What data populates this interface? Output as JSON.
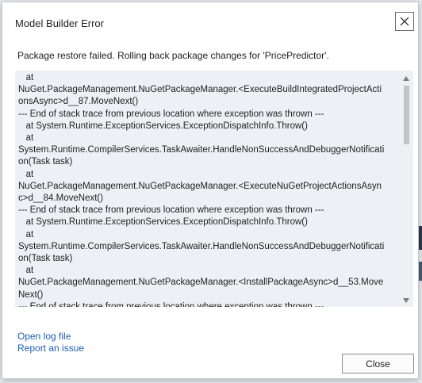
{
  "dialog": {
    "title": "Model Builder Error",
    "close_icon": "close-icon",
    "message": "Package restore failed. Rolling back package changes for 'PricePredictor'.",
    "stack_trace_lines": [
      "   at",
      "NuGet.PackageManagement.NuGetPackageManager.<ExecuteBuildIntegratedProjectActi",
      "onsAsync>d__87.MoveNext()",
      "--- End of stack trace from previous location where exception was thrown ---",
      "   at System.Runtime.ExceptionServices.ExceptionDispatchInfo.Throw()",
      "   at",
      "System.Runtime.CompilerServices.TaskAwaiter.HandleNonSuccessAndDebuggerNotificati",
      "on(Task task)",
      "   at",
      "NuGet.PackageManagement.NuGetPackageManager.<ExecuteNuGetProjectActionsAsyn",
      "c>d__84.MoveNext()",
      "--- End of stack trace from previous location where exception was thrown ---",
      "   at System.Runtime.ExceptionServices.ExceptionDispatchInfo.Throw()",
      "   at",
      "System.Runtime.CompilerServices.TaskAwaiter.HandleNonSuccessAndDebuggerNotificati",
      "on(Task task)",
      "   at",
      "NuGet.PackageManagement.NuGetPackageManager.<InstallPackageAsync>d__53.Move",
      "Next()",
      "--- End of stack trace from previous location where exception was thrown ---"
    ],
    "links": {
      "open_log_file": "Open log file",
      "report_issue": "Report an issue"
    },
    "close_button_label": "Close"
  }
}
